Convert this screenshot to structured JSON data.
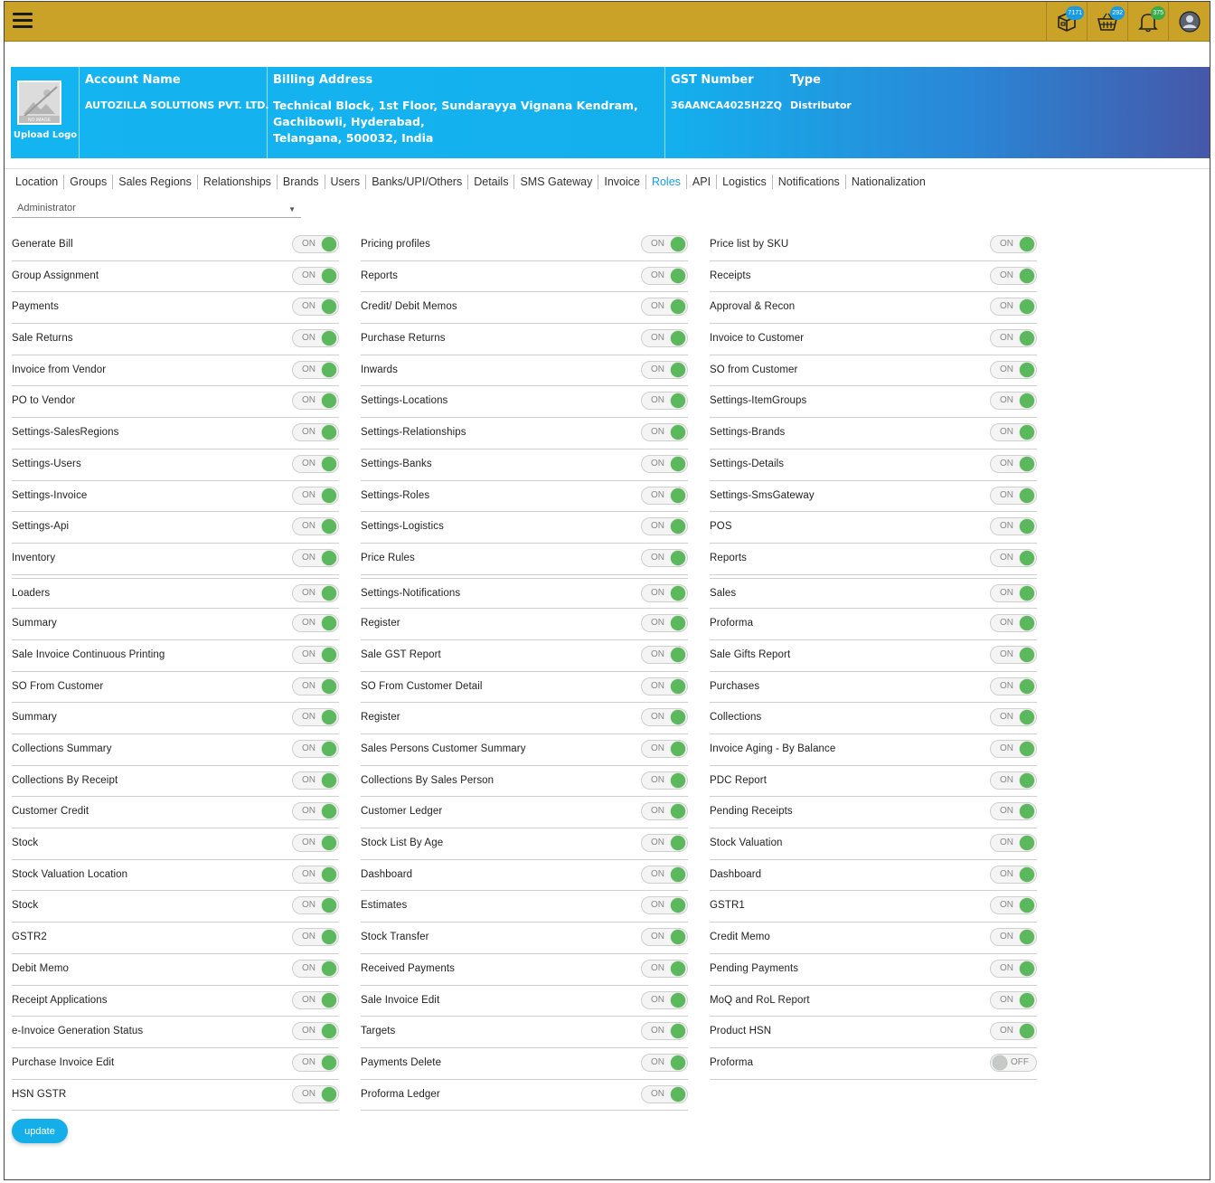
{
  "topbar": {
    "menu_icon": "hamburger-menu-icon",
    "badges": {
      "packages": "7171",
      "cart": "292",
      "notifications": "375"
    },
    "badge_colors": {
      "packages": "#1a9be0",
      "cart": "#1a9be0",
      "notifications": "#3aaa4a"
    }
  },
  "account": {
    "upload_logo": "Upload Logo",
    "no_image": "NO IMAGE",
    "account_name_label": "Account Name",
    "account_name": "AUTOZILLA SOLUTIONS PVT. LTD.",
    "billing_label": "Billing Address",
    "billing_line1": "Technical Block, 1st Floor, Sundarayya Vignana Kendram,",
    "billing_line2": "Gachibowli, Hyderabad,",
    "billing_line3": "Telangana, 500032, India",
    "gst_label": "GST Number",
    "gst_number": "36AANCA4025H2ZQ",
    "type_label": "Type",
    "type_value": "Distributor"
  },
  "tabs": [
    "Location",
    "Groups",
    "Sales Regions",
    "Relationships",
    "Brands",
    "Users",
    "Banks/UPI/Others",
    "Details",
    "SMS Gateway",
    "Invoice",
    "Roles",
    "API",
    "Logistics",
    "Notifications",
    "Nationalization"
  ],
  "active_tab": "Roles",
  "role_select": {
    "value": "Administrator"
  },
  "toggle_on_label": "ON",
  "toggle_off_label": "OFF",
  "permissions": {
    "col1": [
      {
        "label": "Generate Bill",
        "on": true
      },
      {
        "label": "Group Assignment",
        "on": true
      },
      {
        "label": "Payments",
        "on": true
      },
      {
        "label": "Sale Returns",
        "on": true
      },
      {
        "label": "Invoice from Vendor",
        "on": true
      },
      {
        "label": "PO to Vendor",
        "on": true
      },
      {
        "label": "Settings-SalesRegions",
        "on": true
      },
      {
        "label": "Settings-Users",
        "on": true
      },
      {
        "label": "Settings-Invoice",
        "on": true
      },
      {
        "label": "Settings-Api",
        "on": true
      },
      {
        "label": "Inventory",
        "on": true
      },
      {
        "label": "Loaders",
        "on": true
      },
      {
        "label": "Summary",
        "on": true
      },
      {
        "label": "Sale Invoice Continuous Printing",
        "on": true
      },
      {
        "label": "SO From Customer",
        "on": true
      },
      {
        "label": "Summary",
        "on": true
      },
      {
        "label": "Collections Summary",
        "on": true
      },
      {
        "label": "Collections By Receipt",
        "on": true
      },
      {
        "label": "Customer Credit",
        "on": true
      },
      {
        "label": "Stock",
        "on": true
      },
      {
        "label": "Stock Valuation Location",
        "on": true
      },
      {
        "label": "Stock",
        "on": true
      },
      {
        "label": "GSTR2",
        "on": true
      },
      {
        "label": "Debit Memo",
        "on": true
      },
      {
        "label": "Receipt Applications",
        "on": true
      },
      {
        "label": "e-Invoice Generation Status",
        "on": true
      },
      {
        "label": "Purchase Invoice Edit",
        "on": true
      },
      {
        "label": "HSN GSTR",
        "on": true
      }
    ],
    "col2": [
      {
        "label": "Pricing profiles",
        "on": true
      },
      {
        "label": "Reports",
        "on": true
      },
      {
        "label": "Credit/ Debit Memos",
        "on": true
      },
      {
        "label": "Purchase Returns",
        "on": true
      },
      {
        "label": "Inwards",
        "on": true
      },
      {
        "label": "Settings-Locations",
        "on": true
      },
      {
        "label": "Settings-Relationships",
        "on": true
      },
      {
        "label": "Settings-Banks",
        "on": true
      },
      {
        "label": "Settings-Roles",
        "on": true
      },
      {
        "label": "Settings-Logistics",
        "on": true
      },
      {
        "label": "Price Rules",
        "on": true
      },
      {
        "label": "Settings-Notifications",
        "on": true
      },
      {
        "label": "Register",
        "on": true
      },
      {
        "label": "Sale GST Report",
        "on": true
      },
      {
        "label": "SO From Customer Detail",
        "on": true
      },
      {
        "label": "Register",
        "on": true
      },
      {
        "label": "Sales Persons Customer Summary",
        "on": true
      },
      {
        "label": "Collections By Sales Person",
        "on": true
      },
      {
        "label": "Customer Ledger",
        "on": true
      },
      {
        "label": "Stock List By Age",
        "on": true
      },
      {
        "label": "Dashboard",
        "on": true
      },
      {
        "label": "Estimates",
        "on": true
      },
      {
        "label": "Stock Transfer",
        "on": true
      },
      {
        "label": "Received Payments",
        "on": true
      },
      {
        "label": "Sale Invoice Edit",
        "on": true
      },
      {
        "label": "Targets",
        "on": true
      },
      {
        "label": "Payments Delete",
        "on": true
      },
      {
        "label": "Proforma Ledger",
        "on": true
      }
    ],
    "col3": [
      {
        "label": "Price list by SKU",
        "on": true
      },
      {
        "label": "Receipts",
        "on": true
      },
      {
        "label": "Approval & Recon",
        "on": true
      },
      {
        "label": "Invoice to Customer",
        "on": true
      },
      {
        "label": "SO from Customer",
        "on": true
      },
      {
        "label": "Settings-ItemGroups",
        "on": true
      },
      {
        "label": "Settings-Brands",
        "on": true
      },
      {
        "label": "Settings-Details",
        "on": true
      },
      {
        "label": "Settings-SmsGateway",
        "on": true
      },
      {
        "label": "POS",
        "on": true
      },
      {
        "label": "Reports",
        "on": true
      },
      {
        "label": "Sales",
        "on": true
      },
      {
        "label": "Proforma",
        "on": true
      },
      {
        "label": "Sale Gifts Report",
        "on": true
      },
      {
        "label": "Purchases",
        "on": true
      },
      {
        "label": "Collections",
        "on": true
      },
      {
        "label": "Invoice Aging - By Balance",
        "on": true
      },
      {
        "label": "PDC Report",
        "on": true
      },
      {
        "label": "Pending Receipts",
        "on": true
      },
      {
        "label": "Stock Valuation",
        "on": true
      },
      {
        "label": "Dashboard",
        "on": true
      },
      {
        "label": "GSTR1",
        "on": true
      },
      {
        "label": "Credit Memo",
        "on": true
      },
      {
        "label": "Pending Payments",
        "on": true
      },
      {
        "label": "MoQ and RoL Report",
        "on": true
      },
      {
        "label": "Product HSN",
        "on": true
      },
      {
        "label": "Proforma",
        "on": false
      }
    ]
  },
  "update_button": "update"
}
